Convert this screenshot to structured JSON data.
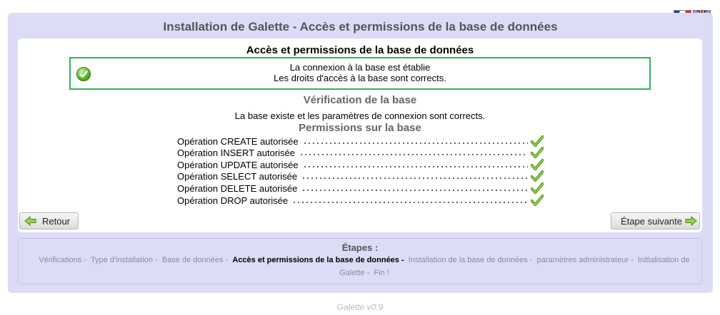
{
  "flags": [
    {
      "name": "Français",
      "code": "fr"
    },
    {
      "name": "English",
      "code": "en"
    }
  ],
  "page_title": "Installation de Galette - Accès et permissions de la base de données",
  "panel": {
    "title": "Accès et permissions de la base de données",
    "success_lines": [
      "La connexion à la base est établie",
      "Les droits d'accès à la base sont corrects."
    ],
    "verification_title": "Vérification de la base",
    "verification_text": "La base existe et les paramètres de connexion sont corrects.",
    "permissions_title": "Permissions sur la base",
    "permissions": [
      {
        "label": "Opération CREATE autorisée",
        "ok": true
      },
      {
        "label": "Opération INSERT autorisée",
        "ok": true
      },
      {
        "label": "Opération UPDATE autorisée",
        "ok": true
      },
      {
        "label": "Opération SELECT autorisée",
        "ok": true
      },
      {
        "label": "Opération DELETE autorisée",
        "ok": true
      },
      {
        "label": "Opération DROP autorisée",
        "ok": true
      }
    ]
  },
  "buttons": {
    "back": "Retour",
    "next": "Étape suivante"
  },
  "steps": {
    "title": "Étapes :",
    "items": [
      {
        "label": "Vérifications",
        "current": false
      },
      {
        "label": "Type d'installation",
        "current": false
      },
      {
        "label": "Base de données",
        "current": false
      },
      {
        "label": "Accès et permissions de la base de données",
        "current": true
      },
      {
        "label": "Installation de la base de données",
        "current": false
      },
      {
        "label": "paramètres administrateur",
        "current": false
      },
      {
        "label": "Initialisation de Galette",
        "current": false
      },
      {
        "label": "Fin !",
        "current": false
      }
    ]
  },
  "footer": "Galette v0.9",
  "colors": {
    "background_panel": "#dcdcf6",
    "success_border": "#2fb45c",
    "check_green": "#6ab82b"
  }
}
